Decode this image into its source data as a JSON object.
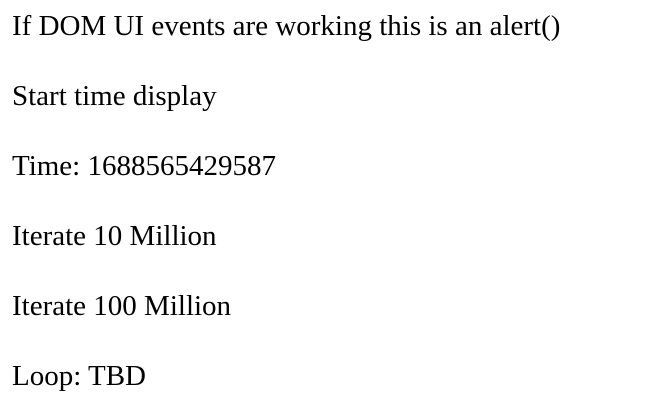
{
  "lines": {
    "alert_trigger": "If DOM UI events are working this is an alert()",
    "start_time_display": "Start time display",
    "time": {
      "label": "Time: ",
      "value": "1688565429587"
    },
    "iterate_10m": "Iterate 10 Million",
    "iterate_100m": "Iterate 100 Million",
    "loop": {
      "label": "Loop: ",
      "value": "TBD"
    }
  }
}
